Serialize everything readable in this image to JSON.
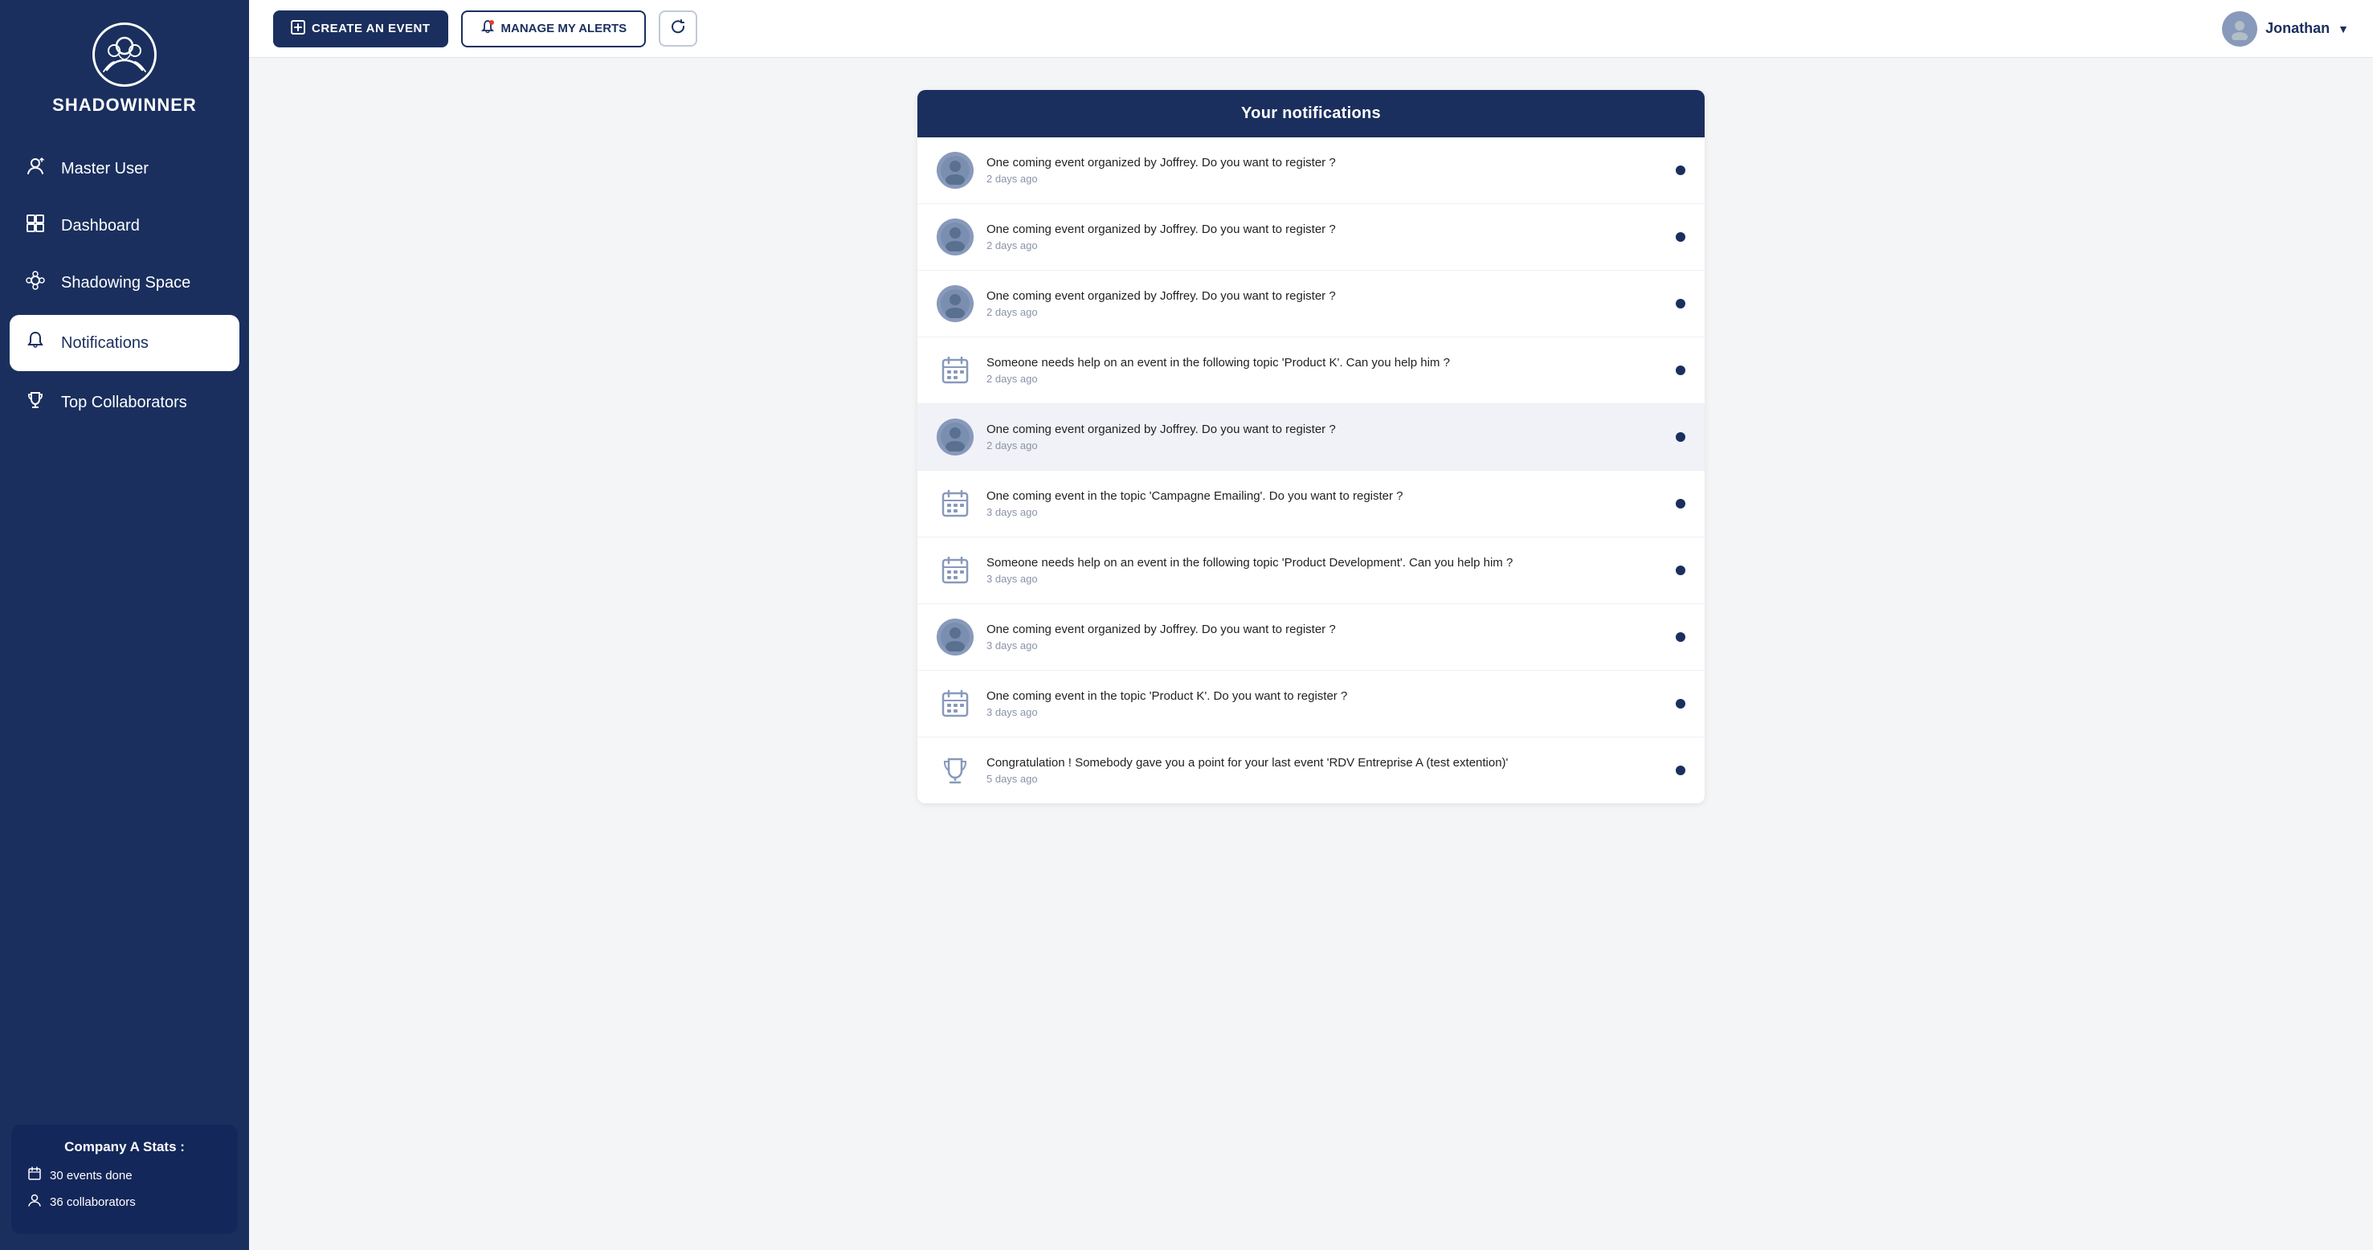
{
  "sidebar": {
    "brand": "SHADOWINNER",
    "items": [
      {
        "id": "master-user",
        "label": "Master User",
        "icon": "👤",
        "active": false
      },
      {
        "id": "dashboard",
        "label": "Dashboard",
        "icon": "⊞",
        "active": false
      },
      {
        "id": "shadowing-space",
        "label": "Shadowing Space",
        "icon": "✦",
        "active": false
      },
      {
        "id": "notifications",
        "label": "Notifications",
        "icon": "🔔",
        "active": true
      },
      {
        "id": "top-collaborators",
        "label": "Top Collaborators",
        "icon": "🏆",
        "active": false
      }
    ],
    "stats": {
      "title": "Company A Stats :",
      "events_label": "30 events done",
      "collaborators_label": "36 collaborators"
    }
  },
  "topbar": {
    "create_label": "CREATE AN EVENT",
    "alerts_label": "MANAGE MY ALERTS",
    "username": "Jonathan"
  },
  "notifications_panel": {
    "header": "Your notifications",
    "items": [
      {
        "id": 1,
        "type": "avatar",
        "text": "One coming event organized by Joffrey. Do you want to register ?",
        "time": "2 days ago",
        "highlighted": false
      },
      {
        "id": 2,
        "type": "avatar",
        "text": "One coming event organized by Joffrey. Do you want to register ?",
        "time": "2 days ago",
        "highlighted": false
      },
      {
        "id": 3,
        "type": "avatar",
        "text": "One coming event organized by Joffrey. Do you want to register ?",
        "time": "2 days ago",
        "highlighted": false
      },
      {
        "id": 4,
        "type": "calendar",
        "text": "Someone needs help on an event in the following topic 'Product K'. Can you help him ?",
        "time": "2 days ago",
        "highlighted": false
      },
      {
        "id": 5,
        "type": "avatar",
        "text": "One coming event organized by Joffrey. Do you want to register ?",
        "time": "2 days ago",
        "highlighted": true
      },
      {
        "id": 6,
        "type": "calendar",
        "text": "One coming event in the topic 'Campagne Emailing'. Do you want to register ?",
        "time": "3 days ago",
        "highlighted": false
      },
      {
        "id": 7,
        "type": "calendar",
        "text": "Someone needs help on an event in the following topic 'Product Development'. Can you help him ?",
        "time": "3 days ago",
        "highlighted": false
      },
      {
        "id": 8,
        "type": "avatar",
        "text": "One coming event organized by Joffrey. Do you want to register ?",
        "time": "3 days ago",
        "highlighted": false
      },
      {
        "id": 9,
        "type": "calendar",
        "text": "One coming event in the topic 'Product K'. Do you want to register ?",
        "time": "3 days ago",
        "highlighted": false
      },
      {
        "id": 10,
        "type": "trophy",
        "text": "Congratulation ! Somebody gave you a point for your last event 'RDV Entreprise A (test extention)'",
        "time": "5 days ago",
        "highlighted": false
      }
    ]
  }
}
